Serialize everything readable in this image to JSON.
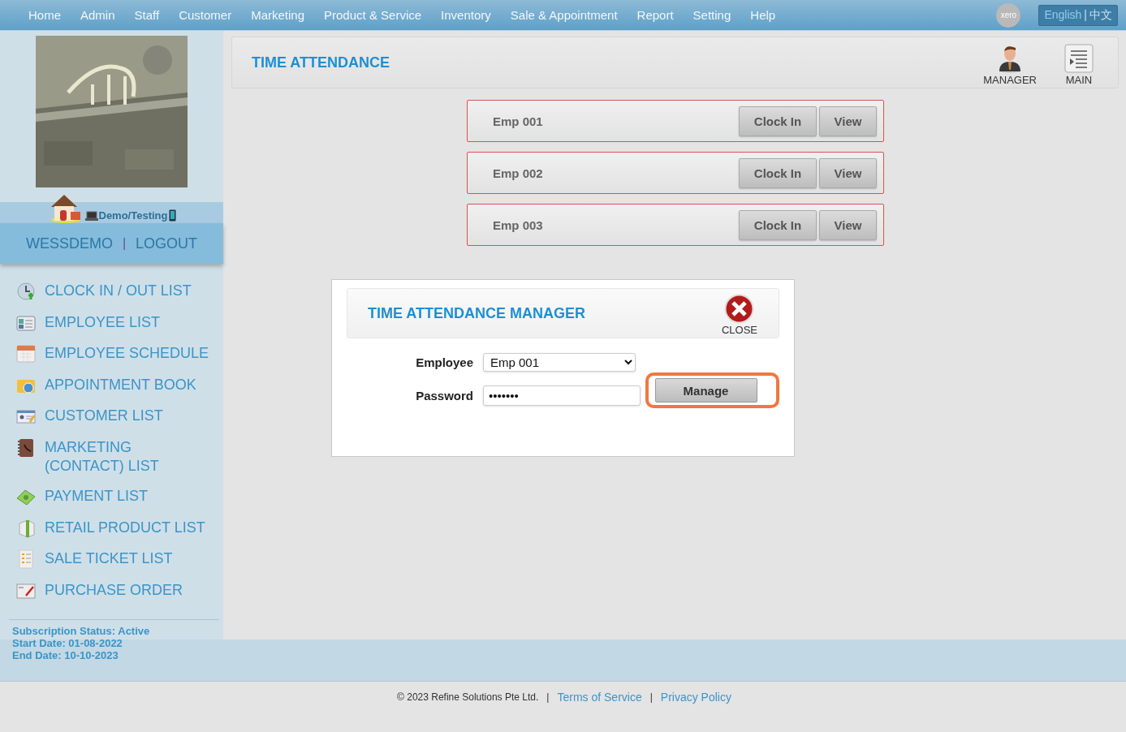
{
  "nav": {
    "items": [
      "Home",
      "Admin",
      "Staff",
      "Customer",
      "Marketing",
      "Product & Service",
      "Inventory",
      "Sale & Appointment",
      "Report",
      "Setting",
      "Help"
    ],
    "xero": "xero",
    "languages": [
      {
        "label": "English",
        "selected": true
      },
      {
        "label": "中文",
        "selected": false
      }
    ],
    "language_separator": "|"
  },
  "sidebar": {
    "site": "Demo/Testing",
    "user": "WESSDEMO",
    "separator": "|",
    "logout": "LOGOUT",
    "menu": [
      "CLOCK IN / OUT LIST",
      "EMPLOYEE LIST",
      "EMPLOYEE SCHEDULE",
      "APPOINTMENT BOOK",
      "CUSTOMER LIST",
      "MARKETING (CONTACT) LIST",
      "PAYMENT LIST",
      "RETAIL PRODUCT LIST",
      "SALE TICKET LIST",
      "PURCHASE ORDER"
    ],
    "subscription": [
      "Subscription Status: Active",
      "Start Date: 01-08-2022",
      "End Date: 10-10-2023"
    ]
  },
  "header": {
    "title": "TIME ATTENDANCE",
    "actions": [
      {
        "kind": "manager",
        "label": "MANAGER"
      },
      {
        "kind": "main",
        "label": "MAIN"
      }
    ]
  },
  "employees": [
    {
      "name": "Emp 001",
      "clock_in": "Clock In",
      "view": "View"
    },
    {
      "name": "Emp 002",
      "clock_in": "Clock In",
      "view": "View"
    },
    {
      "name": "Emp 003",
      "clock_in": "Clock In",
      "view": "View"
    }
  ],
  "dialog": {
    "title": "TIME ATTENDANCE MANAGER",
    "close": "CLOSE",
    "employee_label": "Employee",
    "employee_value": "Emp 001",
    "password_label": "Password",
    "password_value": "•••••••",
    "button": "Manage",
    "button_highlighted": true
  },
  "footer": {
    "copyright": "© 2023 Refine Solutions Pte Ltd.",
    "sep1": "|",
    "terms": "Terms of Service",
    "sep2": "|",
    "privacy": "Privacy Policy"
  }
}
